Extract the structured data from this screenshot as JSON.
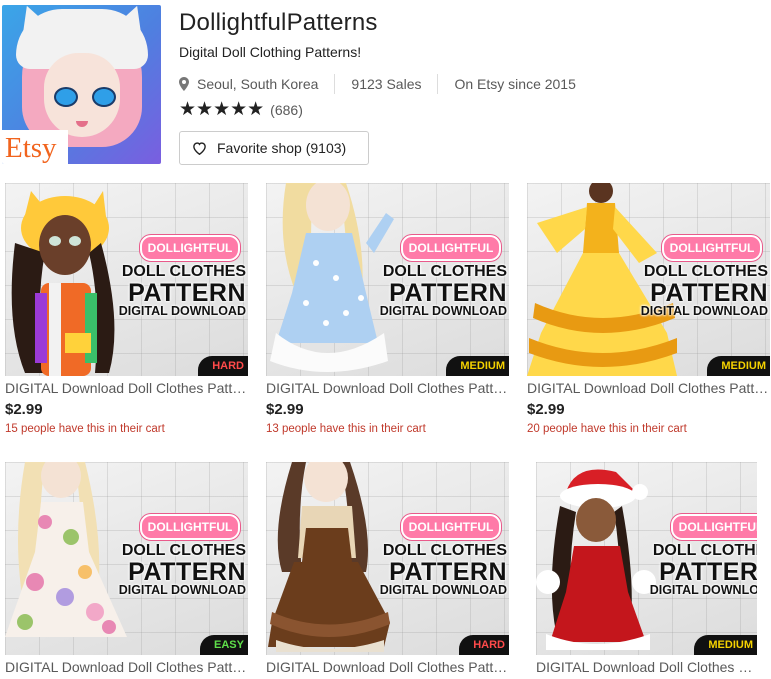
{
  "shop": {
    "name": "DollightfulPatterns",
    "tagline": "Digital Doll Clothing Patterns!",
    "location": "Seoul, South Korea",
    "sales": "9123 Sales",
    "since": "On Etsy since 2015",
    "stars": "★★★★★",
    "review_count": "(686)",
    "favorite_label": "Favorite shop (9103)",
    "badge_text": "Etsy"
  },
  "listing_text": {
    "brand": "DOLLIGHTFUL",
    "line1": "DOLL CLOTHES",
    "line2": "PATTERN",
    "line3": "DIGITAL DOWNLOAD"
  },
  "listings": [
    {
      "title": "DIGITAL Download Doll Clothes Pattern",
      "price": "$2.99",
      "cart": "15 people have this in their cart",
      "difficulty": "HARD"
    },
    {
      "title": "DIGITAL Download Doll Clothes Pattern",
      "price": "$2.99",
      "cart": "13 people have this in their cart",
      "difficulty": "MEDIUM"
    },
    {
      "title": "DIGITAL Download Doll Clothes Pattern",
      "price": "$2.99",
      "cart": "20 people have this in their cart",
      "difficulty": "MEDIUM"
    },
    {
      "title": "DIGITAL Download Doll Clothes Pattern",
      "difficulty": "EASY"
    },
    {
      "title": "DIGITAL Download Doll Clothes Pattern",
      "difficulty": "HARD"
    },
    {
      "title": "DIGITAL Download Doll Clothes Pattern",
      "difficulty": "MEDIUM"
    }
  ],
  "colors": {
    "etsy_orange": "#f1641e",
    "cart_red": "#c0392b",
    "brand_pink": "#ff7aa8"
  }
}
